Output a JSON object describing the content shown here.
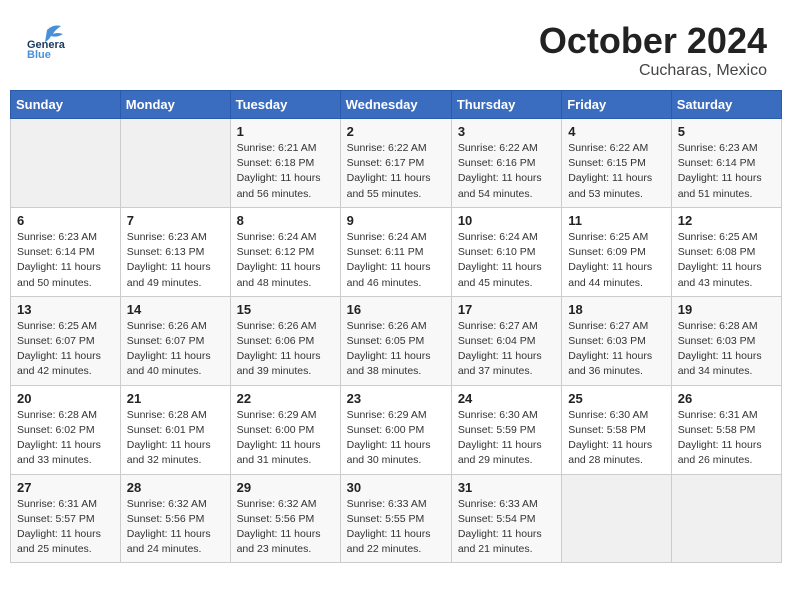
{
  "header": {
    "logo_general": "General",
    "logo_blue": "Blue",
    "month_title": "October 2024",
    "location": "Cucharas, Mexico"
  },
  "weekdays": [
    "Sunday",
    "Monday",
    "Tuesday",
    "Wednesday",
    "Thursday",
    "Friday",
    "Saturday"
  ],
  "weeks": [
    [
      {
        "day": "",
        "info": ""
      },
      {
        "day": "",
        "info": ""
      },
      {
        "day": "1",
        "info": "Sunrise: 6:21 AM\nSunset: 6:18 PM\nDaylight: 11 hours and 56 minutes."
      },
      {
        "day": "2",
        "info": "Sunrise: 6:22 AM\nSunset: 6:17 PM\nDaylight: 11 hours and 55 minutes."
      },
      {
        "day": "3",
        "info": "Sunrise: 6:22 AM\nSunset: 6:16 PM\nDaylight: 11 hours and 54 minutes."
      },
      {
        "day": "4",
        "info": "Sunrise: 6:22 AM\nSunset: 6:15 PM\nDaylight: 11 hours and 53 minutes."
      },
      {
        "day": "5",
        "info": "Sunrise: 6:23 AM\nSunset: 6:14 PM\nDaylight: 11 hours and 51 minutes."
      }
    ],
    [
      {
        "day": "6",
        "info": "Sunrise: 6:23 AM\nSunset: 6:14 PM\nDaylight: 11 hours and 50 minutes."
      },
      {
        "day": "7",
        "info": "Sunrise: 6:23 AM\nSunset: 6:13 PM\nDaylight: 11 hours and 49 minutes."
      },
      {
        "day": "8",
        "info": "Sunrise: 6:24 AM\nSunset: 6:12 PM\nDaylight: 11 hours and 48 minutes."
      },
      {
        "day": "9",
        "info": "Sunrise: 6:24 AM\nSunset: 6:11 PM\nDaylight: 11 hours and 46 minutes."
      },
      {
        "day": "10",
        "info": "Sunrise: 6:24 AM\nSunset: 6:10 PM\nDaylight: 11 hours and 45 minutes."
      },
      {
        "day": "11",
        "info": "Sunrise: 6:25 AM\nSunset: 6:09 PM\nDaylight: 11 hours and 44 minutes."
      },
      {
        "day": "12",
        "info": "Sunrise: 6:25 AM\nSunset: 6:08 PM\nDaylight: 11 hours and 43 minutes."
      }
    ],
    [
      {
        "day": "13",
        "info": "Sunrise: 6:25 AM\nSunset: 6:07 PM\nDaylight: 11 hours and 42 minutes."
      },
      {
        "day": "14",
        "info": "Sunrise: 6:26 AM\nSunset: 6:07 PM\nDaylight: 11 hours and 40 minutes."
      },
      {
        "day": "15",
        "info": "Sunrise: 6:26 AM\nSunset: 6:06 PM\nDaylight: 11 hours and 39 minutes."
      },
      {
        "day": "16",
        "info": "Sunrise: 6:26 AM\nSunset: 6:05 PM\nDaylight: 11 hours and 38 minutes."
      },
      {
        "day": "17",
        "info": "Sunrise: 6:27 AM\nSunset: 6:04 PM\nDaylight: 11 hours and 37 minutes."
      },
      {
        "day": "18",
        "info": "Sunrise: 6:27 AM\nSunset: 6:03 PM\nDaylight: 11 hours and 36 minutes."
      },
      {
        "day": "19",
        "info": "Sunrise: 6:28 AM\nSunset: 6:03 PM\nDaylight: 11 hours and 34 minutes."
      }
    ],
    [
      {
        "day": "20",
        "info": "Sunrise: 6:28 AM\nSunset: 6:02 PM\nDaylight: 11 hours and 33 minutes."
      },
      {
        "day": "21",
        "info": "Sunrise: 6:28 AM\nSunset: 6:01 PM\nDaylight: 11 hours and 32 minutes."
      },
      {
        "day": "22",
        "info": "Sunrise: 6:29 AM\nSunset: 6:00 PM\nDaylight: 11 hours and 31 minutes."
      },
      {
        "day": "23",
        "info": "Sunrise: 6:29 AM\nSunset: 6:00 PM\nDaylight: 11 hours and 30 minutes."
      },
      {
        "day": "24",
        "info": "Sunrise: 6:30 AM\nSunset: 5:59 PM\nDaylight: 11 hours and 29 minutes."
      },
      {
        "day": "25",
        "info": "Sunrise: 6:30 AM\nSunset: 5:58 PM\nDaylight: 11 hours and 28 minutes."
      },
      {
        "day": "26",
        "info": "Sunrise: 6:31 AM\nSunset: 5:58 PM\nDaylight: 11 hours and 26 minutes."
      }
    ],
    [
      {
        "day": "27",
        "info": "Sunrise: 6:31 AM\nSunset: 5:57 PM\nDaylight: 11 hours and 25 minutes."
      },
      {
        "day": "28",
        "info": "Sunrise: 6:32 AM\nSunset: 5:56 PM\nDaylight: 11 hours and 24 minutes."
      },
      {
        "day": "29",
        "info": "Sunrise: 6:32 AM\nSunset: 5:56 PM\nDaylight: 11 hours and 23 minutes."
      },
      {
        "day": "30",
        "info": "Sunrise: 6:33 AM\nSunset: 5:55 PM\nDaylight: 11 hours and 22 minutes."
      },
      {
        "day": "31",
        "info": "Sunrise: 6:33 AM\nSunset: 5:54 PM\nDaylight: 11 hours and 21 minutes."
      },
      {
        "day": "",
        "info": ""
      },
      {
        "day": "",
        "info": ""
      }
    ]
  ]
}
